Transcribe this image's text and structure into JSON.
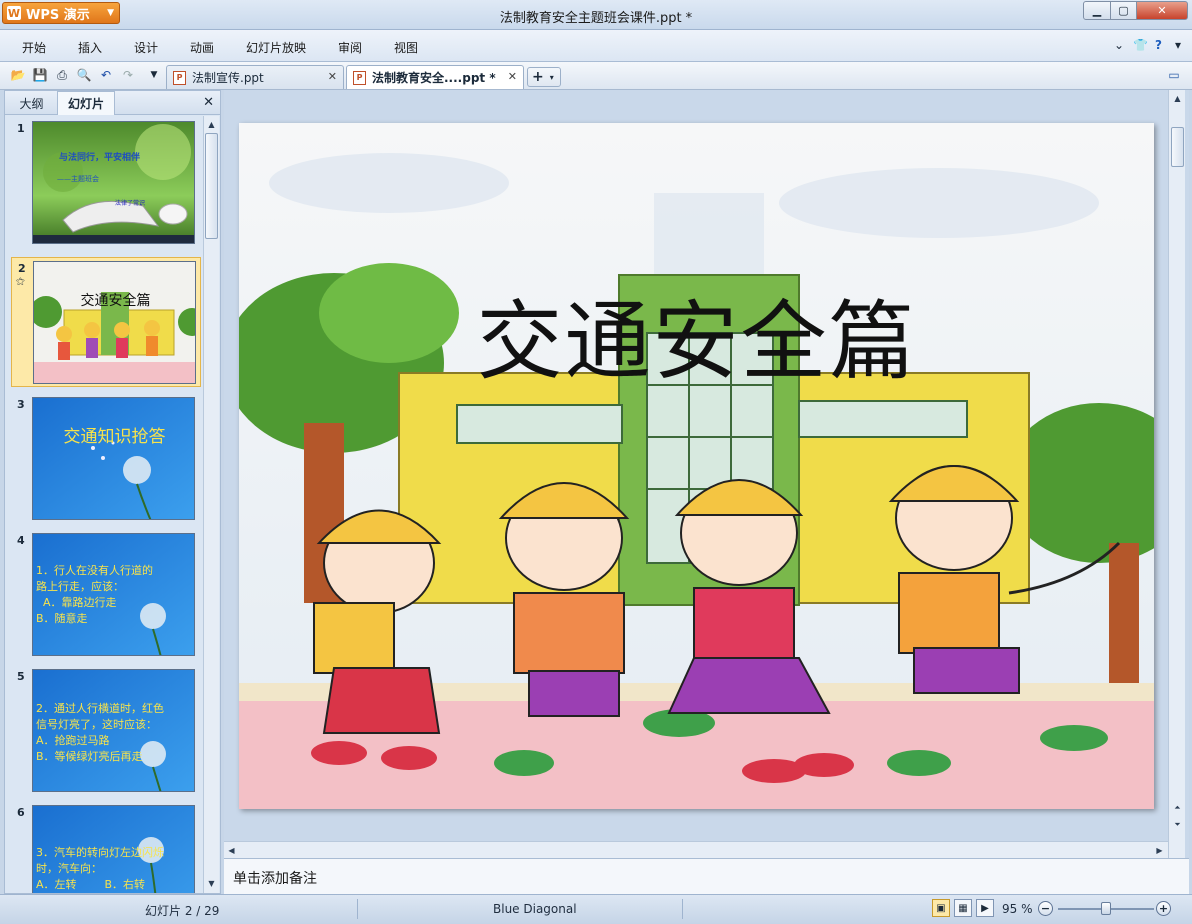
{
  "app": {
    "button_label": "WPS 演示",
    "logo_glyph": "W",
    "window_title": "法制教育安全主题班会课件.ppt *"
  },
  "menu": {
    "items": [
      "开始",
      "插入",
      "设计",
      "动画",
      "幻灯片放映",
      "审阅",
      "视图"
    ]
  },
  "tabs": [
    {
      "label": "法制宣传.ppt",
      "active": false
    },
    {
      "label": "法制教育安全....ppt *",
      "active": true
    }
  ],
  "left_panel": {
    "tab_outline": "大纲",
    "tab_slides": "幻灯片",
    "thumbnails": [
      {
        "num": "1",
        "lines": [
          "与法同行，平安相伴",
          "——主题班会",
          "法律了常识"
        ],
        "bg": "green"
      },
      {
        "num": "2",
        "lines": [
          "交通安全篇"
        ],
        "bg": "cartoon",
        "selected": true,
        "marker": "⚝"
      },
      {
        "num": "3",
        "lines": [
          "交通知识抢答"
        ],
        "bg": "blue"
      },
      {
        "num": "4",
        "lines": [
          "1．行人在没有人行道的",
          "路上行走，应该：",
          "  A．靠路边行走",
          "B．随意走"
        ],
        "bg": "blue"
      },
      {
        "num": "5",
        "lines": [
          "2．通过人行横道时，红色",
          "信号灯亮了，这时应该：",
          "A．抢跑过马路",
          "B．等候绿灯亮后再走"
        ],
        "bg": "blue"
      },
      {
        "num": "6",
        "lines": [
          "3．汽车的转向灯左边闪烁",
          "时，汽车向：",
          "A．左转        B．右转"
        ],
        "bg": "blue"
      }
    ]
  },
  "slide": {
    "title": "交通安全篇"
  },
  "notes": {
    "placeholder": "单击添加备注"
  },
  "status": {
    "slide_counter": "幻灯片 2 / 29",
    "theme": "Blue Diagonal",
    "zoom": "95 %",
    "zoom_level": 0.5
  }
}
